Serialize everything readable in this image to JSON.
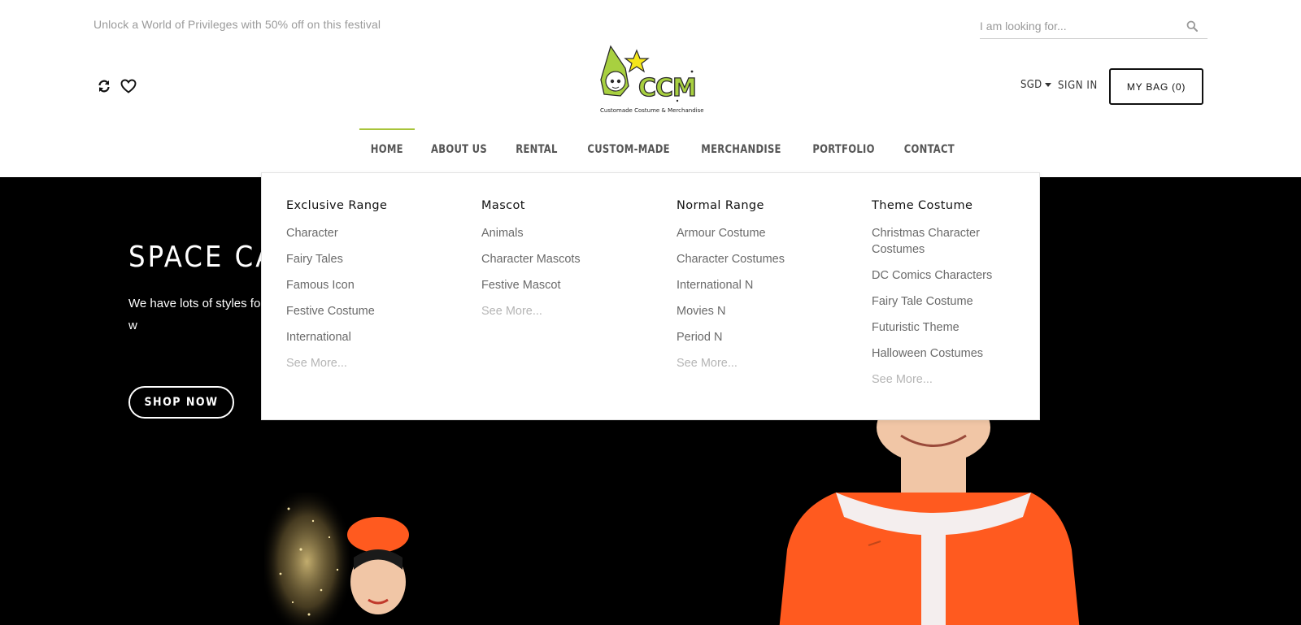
{
  "header": {
    "promo": "Unlock a World of Privileges with 50% off on this festival",
    "search": {
      "placeholder": "I am looking for..."
    },
    "logo": {
      "text": "CCM",
      "tagline": "Customade Costume & Merchandise"
    },
    "currency": "SGD",
    "signin": "SIGN IN",
    "bag": {
      "label": "MY BAG",
      "count": "(0)"
    },
    "icons": [
      "refresh-icon",
      "heart-icon",
      "search-icon"
    ]
  },
  "nav": {
    "items": [
      {
        "label": "HOME",
        "active": true
      },
      {
        "label": "ABOUT US"
      },
      {
        "label": "RENTAL"
      },
      {
        "label": "CUSTOM-MADE"
      },
      {
        "label": "MERCHANDISE"
      },
      {
        "label": "PORTFOLIO"
      },
      {
        "label": "CONTACT"
      }
    ]
  },
  "mega_menu": {
    "columns": [
      {
        "title": "Exclusive Range",
        "items": [
          "Character",
          "Fairy Tales",
          "Famous Icon",
          "Festive Costume",
          "International"
        ],
        "more": "See More..."
      },
      {
        "title": "Mascot",
        "items": [
          "Animals",
          "Character Mascots",
          "Festive Mascot"
        ],
        "more": "See More..."
      },
      {
        "title": "Normal Range",
        "items": [
          "Armour Costume",
          "Character Costumes",
          "International N",
          "Movies N",
          "Period N"
        ],
        "more": "See More..."
      },
      {
        "title": "Theme Costume",
        "items": [
          "Christmas Character Costumes",
          "DC Comics Characters",
          "Fairy Tale Costume",
          "Futuristic Theme",
          "Halloween Costumes"
        ],
        "more": "See More..."
      }
    ]
  },
  "hero": {
    "title": "SPACE CAD",
    "text": "We have lots of styles fo wow! Update yourself w",
    "button": "SHOP NOW"
  },
  "colors": {
    "accent": "#a8c43a",
    "hero_bg": "#000000",
    "costume": "#ff5a1f"
  }
}
